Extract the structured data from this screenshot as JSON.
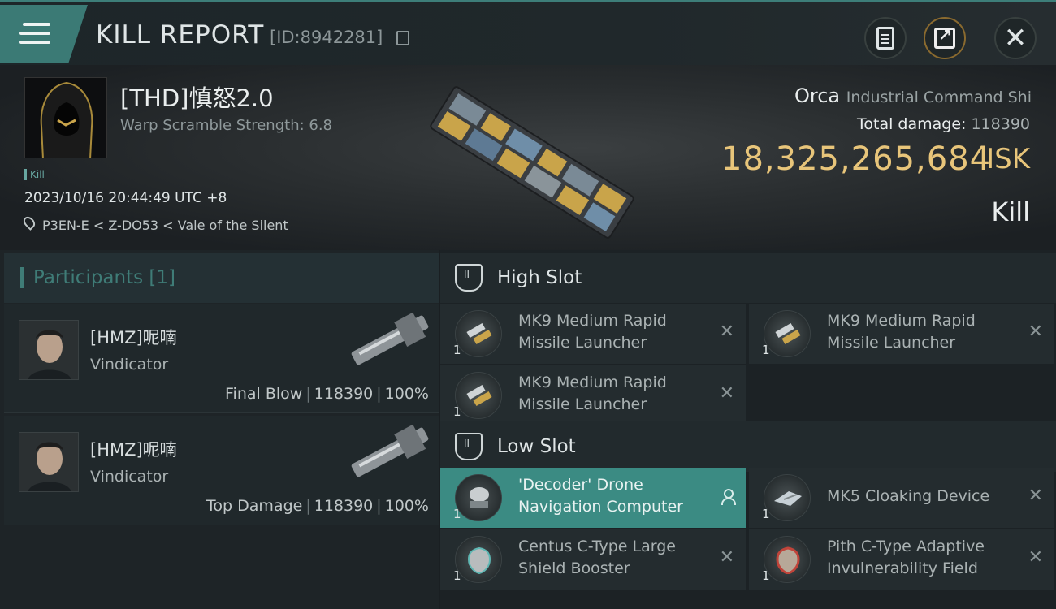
{
  "header": {
    "title": "KILL REPORT",
    "report_id": "[ID:8942281]"
  },
  "victim": {
    "name": "[THD]慎怒2.0",
    "warp_scramble": "Warp Scramble Strength: 6.8",
    "tag": "Kill",
    "datetime": "2023/10/16 20:44:49 UTC +8",
    "location": "P3EN-E < Z-DO53 < Vale of the Silent",
    "ship_name": "Orca",
    "ship_class": "Industrial Command Shi",
    "total_damage_label": "Total damage:",
    "total_damage": "118390",
    "isk_value": "18,325,265,684",
    "isk_unit": "ISK",
    "result": "Kill"
  },
  "participants": {
    "title": "Participants",
    "count": "[1]",
    "rows": [
      {
        "name": "[HMZ]呢喃",
        "ship": "Vindicator",
        "role": "Final Blow",
        "damage": "118390",
        "percent": "100%"
      },
      {
        "name": "[HMZ]呢喃",
        "ship": "Vindicator",
        "role": "Top Damage",
        "damage": "118390",
        "percent": "100%"
      }
    ]
  },
  "slots": {
    "high": {
      "title": "High Slot",
      "modules": [
        {
          "name": "MK9 Medium Rapid Missile Launcher",
          "qty": "1"
        },
        {
          "name": "MK9 Medium Rapid Missile Launcher",
          "qty": "1"
        },
        {
          "name": "MK9 Medium Rapid Missile Launcher",
          "qty": "1"
        }
      ]
    },
    "low": {
      "title": "Low Slot",
      "modules": [
        {
          "name": "'Decoder' Drone Navigation Computer",
          "qty": "1"
        },
        {
          "name": "MK5 Cloaking Device",
          "qty": "1"
        },
        {
          "name": "Centus C-Type Large Shield Booster",
          "qty": "1"
        },
        {
          "name": "Pith C-Type Adaptive Invulnerability Field",
          "qty": "1"
        }
      ]
    }
  },
  "colors": {
    "accent": "#3b7a75",
    "isk": "#e8c57a",
    "active_module": "#3b8b83"
  }
}
